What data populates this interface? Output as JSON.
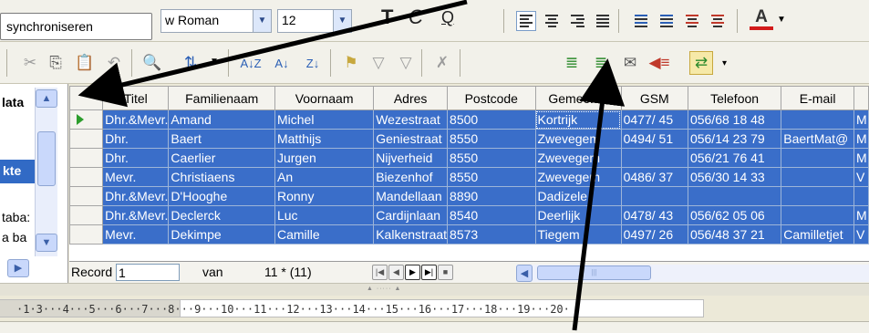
{
  "format_toolbar": {
    "tooltip_text": "synchroniseren",
    "font_name": "w Roman",
    "font_size": "12",
    "bold_glyph": "T",
    "italic_glyph": "C",
    "underline_glyph": "Q",
    "font_color_glyph": "A"
  },
  "navigator": {
    "items": [
      "lata",
      "kte",
      "taba:",
      "a ba"
    ]
  },
  "grid": {
    "columns": [
      "",
      "Titel",
      "Familienaam",
      "Voornaam",
      "Adres",
      "Postcode",
      "Gemeente",
      "GSM",
      "Telefoon",
      "E-mail",
      ""
    ],
    "rows": [
      [
        "Dhr.&Mevr.",
        "Amand",
        "Michel",
        "Wezestraat",
        "8500",
        "Kortrijk",
        "0477/ 45",
        "056/68 18 48",
        "",
        "M"
      ],
      [
        "Dhr.",
        "Baert",
        "Matthijs",
        "Geniestraat",
        "8550",
        "Zwevegem",
        "0494/ 51",
        "056/14 23 79",
        "BaertMat@",
        "M"
      ],
      [
        "Dhr.",
        "Caerlier",
        "Jurgen",
        "Nijverheid",
        "8550",
        "Zwevegem",
        "",
        "056/21 76 41",
        "",
        "M"
      ],
      [
        "Mevr.",
        "Christiaens",
        "An",
        "Biezenhof",
        "8550",
        "Zwevegem",
        "0486/ 37",
        "056/30 14 33",
        "",
        "V"
      ],
      [
        "Dhr.&Mevr.",
        "D'Hooghe",
        "Ronny",
        "Mandellaan",
        "8890",
        "Dadizele",
        "",
        "",
        "",
        ""
      ],
      [
        "Dhr.&Mevr.",
        "Declerck",
        "Luc",
        "Cardijnlaan",
        "8540",
        "Deerlijk",
        "0478/ 43",
        "056/62 05 06",
        "",
        "M"
      ],
      [
        "Mevr.",
        "Dekimpe",
        "Camille",
        "Kalkenstraat",
        "8573",
        "Tiegem",
        "0497/ 26",
        "056/48 37 21",
        "Camilletjet",
        "V"
      ]
    ]
  },
  "record_nav": {
    "record_label": "Record",
    "record_value": "1",
    "of_label": "van",
    "count_text": "11 * (11)"
  },
  "ruler": {
    "text": "·1·3···4···5···6···7···8···9···10···11···12···13···14···15···16···17···18···19···20·"
  },
  "icons": {
    "selected_tool": "data-to-text-icon"
  }
}
